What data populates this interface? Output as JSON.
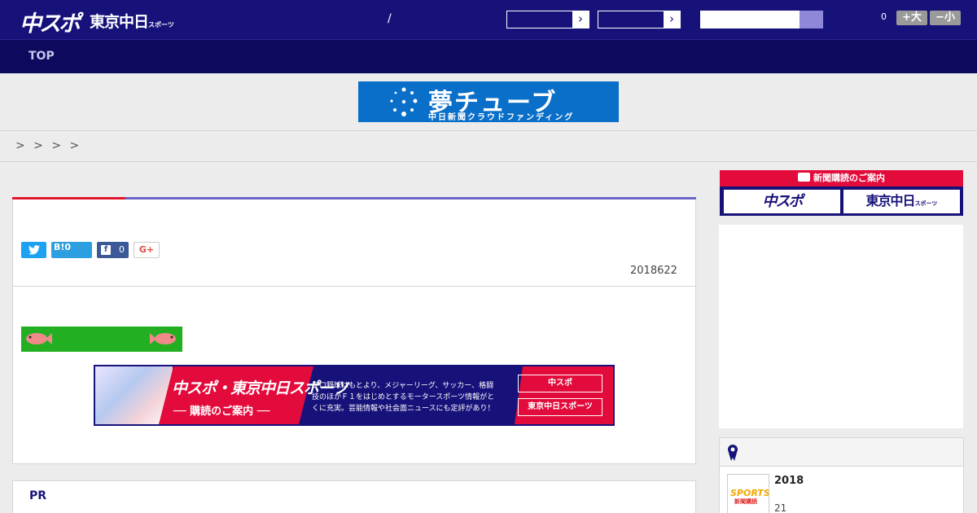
{
  "header": {
    "logo_chuspo": "中スポ",
    "logo_tokyo": "東京中日",
    "logo_tokyo_small": "スポーツ",
    "slash": "/",
    "select_arrow": "›",
    "count": "0",
    "font_up": "+大",
    "font_down": "−小"
  },
  "nav": {
    "top": "TOP"
  },
  "banner": {
    "title": "夢チューブ",
    "subtitle": "中日新聞クラウドファンディング"
  },
  "breadcrumb": "> > > >",
  "article": {
    "date": "2018622",
    "share": {
      "twitter_icon": "twitter-icon",
      "hatena_label": "B!",
      "hatena_count": "0",
      "facebook_icon": "f",
      "facebook_count": "0",
      "gplus_label": "G+"
    }
  },
  "ad": {
    "headline": "中スポ・東京中日スポーツ",
    "subhead": "── 購読のご案内 ──",
    "description": "プロ野球はもとより、メジャーリーグ、サッカー、格闘技のほかＦ１をはじめとするモータースポーツ情報がとくに充実。芸能情報や社会面ニュースにも定評があり！",
    "button1": "中スポ",
    "button2": "東京中日スポーツ"
  },
  "pr": {
    "label": "PR"
  },
  "sidebar": {
    "subscription_head": "新聞購読のご案内",
    "sub_btn1": "中スポ",
    "sub_btn2": "東京中日",
    "sub_btn2_small": "スポーツ",
    "ranking": {
      "item_title": "2018",
      "item_sub": "21",
      "thumb_text": "SPORTS!!",
      "thumb_text2": "新聞購読"
    }
  },
  "colors": {
    "header_bg": "#17127a",
    "nav_bg": "#0d0a5e",
    "accent_red": "#e30b3c",
    "accent_purple": "#6b64c8",
    "banner_blue": "#0a6fc8"
  }
}
